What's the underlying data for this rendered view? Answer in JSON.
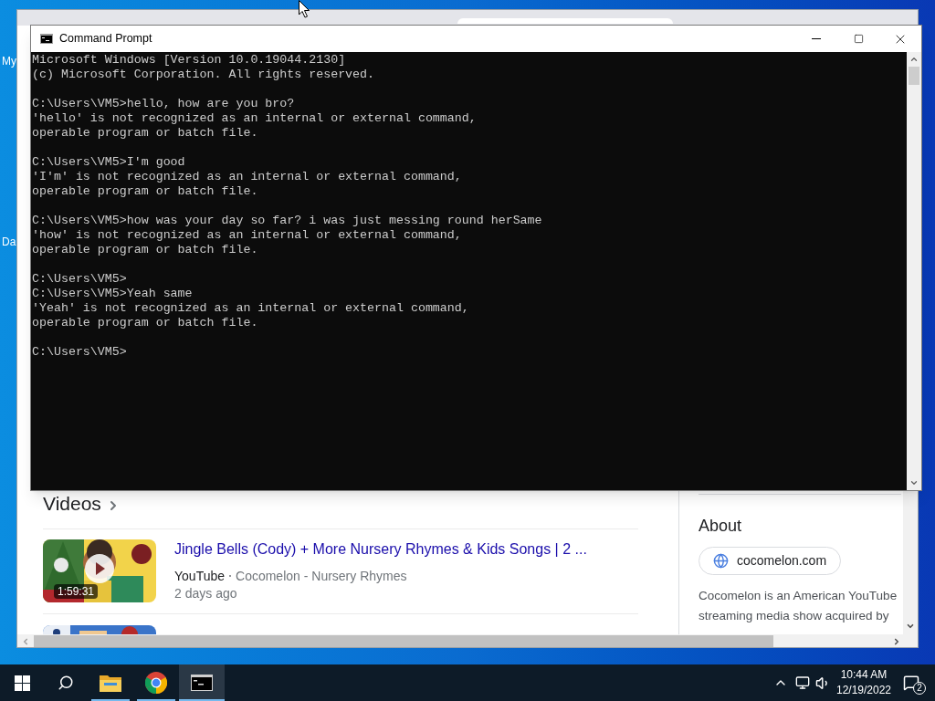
{
  "desktop": {
    "icons": [
      {
        "label": "My"
      },
      {
        "label": "Da"
      }
    ]
  },
  "browser": {
    "section_title": "Videos",
    "videos": [
      {
        "title": "Jingle Bells (Cody) + More Nursery Rhymes & Kids Songs | 2 ...",
        "source": "YouTube",
        "channel": "Cocomelon - Nursery Rhymes",
        "age": "2 days ago",
        "duration": "1:59:31"
      }
    ],
    "about": {
      "title": "About",
      "site": "cocomelon.com",
      "description_lines": [
        "Cocomelon is an American YouTube",
        "streaming media show acquired by"
      ]
    }
  },
  "console_window": {
    "title": "Command Prompt",
    "blocks": [
      [
        "Microsoft Windows [Version 10.0.19044.2130]",
        "(c) Microsoft Corporation. All rights reserved."
      ],
      [
        "C:\\Users\\VM5>hello, how are you bro?",
        "'hello' is not recognized as an internal or external command,",
        "operable program or batch file."
      ],
      [
        "C:\\Users\\VM5>I'm good",
        "'I'm' is not recognized as an internal or external command,",
        "operable program or batch file."
      ],
      [
        "C:\\Users\\VM5>how was your day so far? i was just messing round herSame",
        "'how' is not recognized as an internal or external command,",
        "operable program or batch file."
      ],
      [
        "C:\\Users\\VM5>",
        "C:\\Users\\VM5>Yeah same",
        "'Yeah' is not recognized as an internal or external command,",
        "operable program or batch file."
      ],
      [
        "C:\\Users\\VM5>"
      ]
    ]
  },
  "taskbar": {
    "apps": [
      {
        "kind": "start",
        "running": false,
        "selected": false
      },
      {
        "kind": "search",
        "running": false,
        "selected": false
      },
      {
        "kind": "files",
        "running": true,
        "selected": false
      },
      {
        "kind": "browser",
        "running": true,
        "selected": false
      },
      {
        "kind": "terminal",
        "running": true,
        "selected": true
      }
    ],
    "time": "10:44 AM",
    "date": "12/19/2022",
    "notification_count": "2"
  }
}
